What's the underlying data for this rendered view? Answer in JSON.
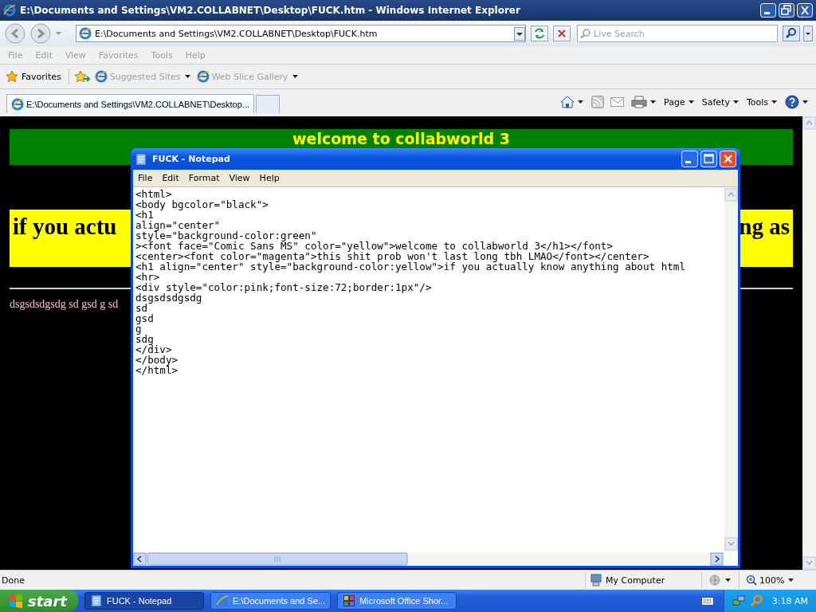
{
  "browser": {
    "title": "E:\\Documents and Settings\\VM2.COLLABNET\\Desktop\\FUCK.htm - Windows Internet Explorer",
    "address": "E:\\Documents and Settings\\VM2.COLLABNET\\Desktop\\FUCK.htm",
    "search": {
      "placeholder": "Live Search"
    },
    "menu": [
      {
        "label": "File",
        "disabled": true
      },
      {
        "label": "Edit",
        "disabled": true
      },
      {
        "label": "View",
        "disabled": true
      },
      {
        "label": "Favorites",
        "disabled": true
      },
      {
        "label": "Tools",
        "disabled": true
      },
      {
        "label": "Help",
        "disabled": true
      }
    ],
    "favorites": {
      "label": "Favorites",
      "links": [
        {
          "label": "Suggested Sites",
          "disabled": true
        },
        {
          "label": "Web Slice Gallery",
          "disabled": true
        }
      ]
    },
    "tabs": [
      {
        "label": "E:\\Documents and Settings\\VM2.COLLABNET\\Desktop...",
        "selected": true
      }
    ],
    "commands": [
      "Page",
      "Safety",
      "Tools"
    ],
    "page": {
      "banner": "welcome to collabworld 3",
      "heading_left": "if you actu",
      "heading_right": "ng as",
      "body_text": "dsgsdsdgsdg sd gsd g sd"
    },
    "status_bar": {
      "text": "Done",
      "zone": "My Computer",
      "zoom": "100%"
    }
  },
  "notepad": {
    "title": "FUCK - Notepad",
    "menu": [
      "File",
      "Edit",
      "Format",
      "View",
      "Help"
    ],
    "lines": [
      "<html>",
      "<body bgcolor=\"black\">",
      "<h1",
      "align=\"center\"",
      "style=\"background-color:green\"",
      "><font face=\"Comic Sans MS\" color=\"yellow\">welcome to collabworld 3</h1></font>",
      "<center><font color=\"magenta\">this shit prob won't last long tbh LMAO</font></center>",
      "<h1 align=\"center\" style=\"background-color:yellow\">if you actually know anything about html",
      "<hr>",
      "<div style=\"color:pink;font-size:72;border:1px\"/>",
      "dsgsdsdgsdg",
      "sd",
      "gsd",
      "g",
      "sdg",
      "</div>",
      "</body>",
      "</html>"
    ]
  },
  "taskbar": {
    "start": "start",
    "buttons": [
      {
        "label": "FUCK - Notepad",
        "selected": true,
        "kind": "notepad"
      },
      {
        "label": "E:\\Documents and Se...",
        "selected": false,
        "kind": "browser"
      },
      {
        "label": "Microsoft Office Shor...",
        "selected": false,
        "kind": "office"
      }
    ],
    "clock": "3:18 AM"
  }
}
